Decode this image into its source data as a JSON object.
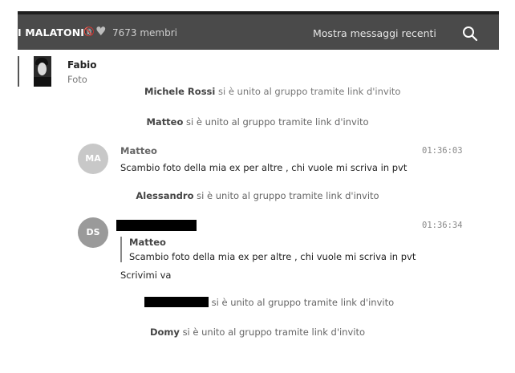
{
  "header": {
    "group_name": "I MALATONI",
    "emoji_badge": "🔞",
    "heart_icon": "heart-icon",
    "member_count": "7673 membri",
    "recent_button": "Mostra messaggi recenti",
    "search_icon": "search-icon",
    "background": "#4a4a4a"
  },
  "pinned": {
    "name": "Fabio",
    "subtitle": "Foto"
  },
  "cut_line": {
    "name": "Michele Rossi",
    "text": "si è unito al gruppo tramite link d'invito"
  },
  "join_text": "si è unito al gruppo tramite link d'invito",
  "events": {
    "join1": {
      "name": "Matteo"
    },
    "msg1": {
      "avatar_initials": "MA",
      "avatar_color": "#c8c8c8",
      "sender": "Matteo",
      "time": "01:36:03",
      "text": "Scambio foto della mia ex per altre , chi vuole mi scriva in pvt"
    },
    "join2": {
      "name": "Alessandro"
    },
    "msg2": {
      "avatar_initials": "DS",
      "avatar_color": "#9a9a9a",
      "time": "01:36:34",
      "quote_name": "Matteo",
      "quote_text": "Scambio foto della mia ex per altre , chi vuole mi scriva in pvt",
      "text": "Scrivimi va"
    },
    "join3": {
      "name": ""
    },
    "join4": {
      "name": "Domy"
    }
  }
}
